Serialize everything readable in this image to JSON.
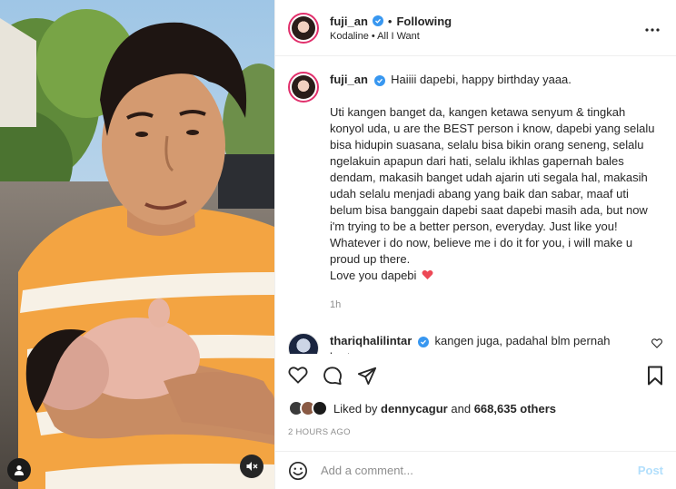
{
  "media": {
    "user_tag_icon": "person-icon",
    "mute_icon": "speaker-muted-icon"
  },
  "header": {
    "username": "fuji_an",
    "separator": "•",
    "follow_state": "Following",
    "audio_line": "Kodaline • All I Want",
    "more_icon": "more-horizontal-icon"
  },
  "caption": {
    "username": "fuji_an",
    "first_line": "Haiiii dapebi, happy birthday yaaa.",
    "body": "Uti kangen banget da, kangen ketawa senyum & tingkah konyol uda, u are the BEST person i know, dapebi yang selalu bisa hidupin suasana, selalu bisa bikin orang seneng, selalu ngelakuin apapun dari hati, selalu ikhlas gapernah bales dendam, makasih banget udah ajarin uti segala hal, makasih udah selalu menjadi abang yang baik dan sabar, maaf uti belum bisa banggain dapebi saat dapebi masih ada, but now i'm trying to be a better person, everyday. Just like you!",
    "line2": "Whatever i do now, believe me i do it for you, i will make u proud up there.",
    "line3": "Love you dapebi",
    "age": "1h"
  },
  "reply": {
    "username": "thariqhalilintar",
    "text": "kangen juga, padahal blm pernah bertemu"
  },
  "likes": {
    "prefix": "Liked by",
    "user": "dennycagur",
    "conjunction": "and",
    "count": "668,635 others"
  },
  "timestamp": "2 HOURS AGO",
  "comment_box": {
    "placeholder": "Add a comment...",
    "post_label": "Post"
  },
  "colors": {
    "verified": "#3897f0",
    "heart": "#ed4956",
    "post_disabled": "#b2dffc"
  }
}
